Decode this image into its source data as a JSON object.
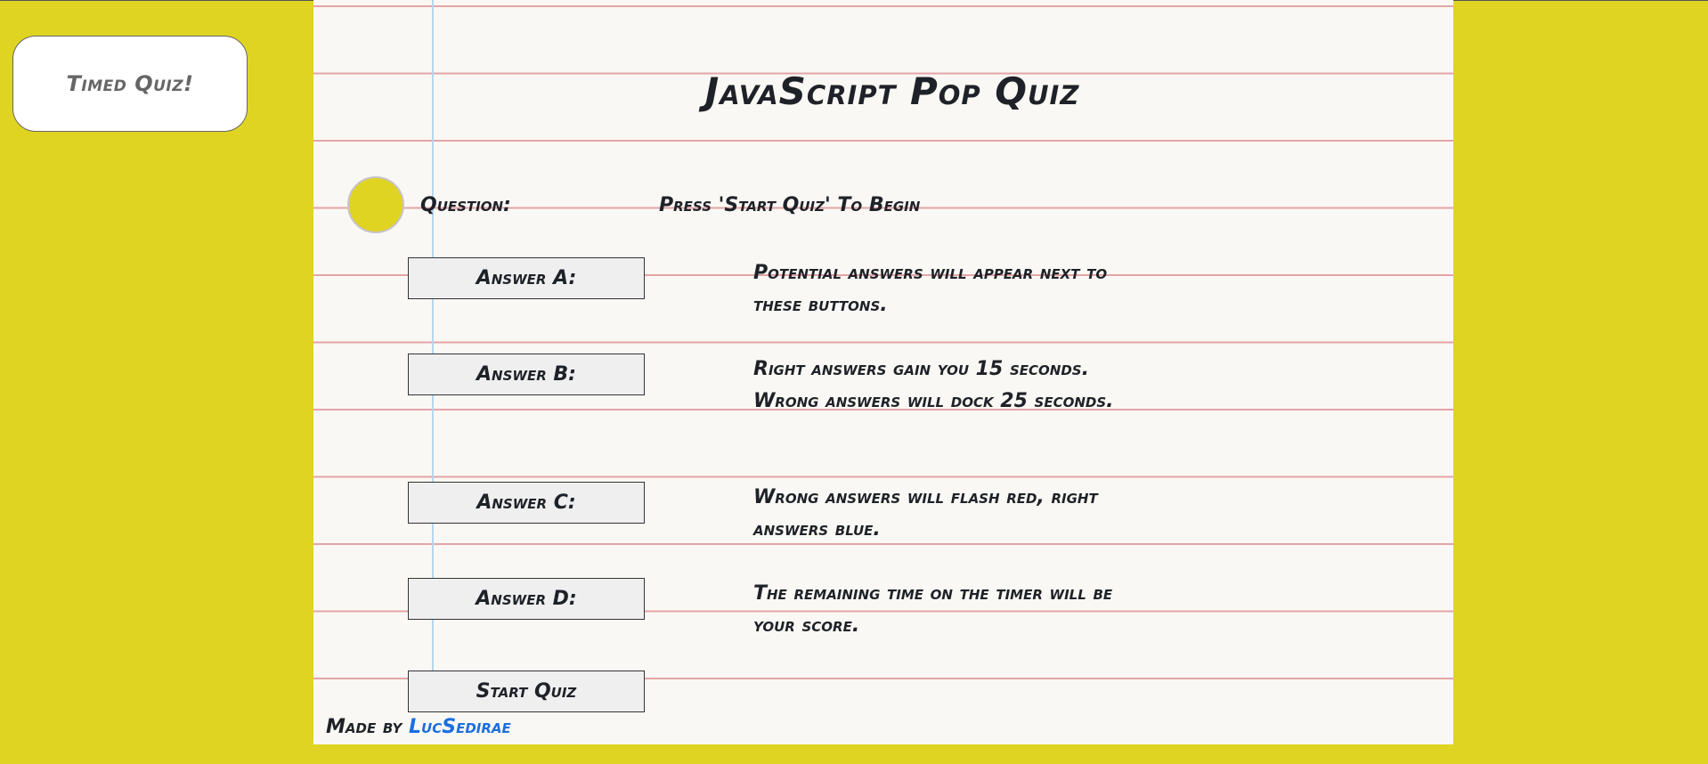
{
  "timer": {
    "label": "Timed Quiz!"
  },
  "header": {
    "title": "JavaScript Pop Quiz"
  },
  "question": {
    "label": "Question:",
    "text": "Press 'Start Quiz' To Begin"
  },
  "answers": [
    {
      "button_label": "Answer A:",
      "text": "Potential answers will appear next to these buttons."
    },
    {
      "button_label": "Answer B:",
      "text": "Right answers gain you 15 seconds. Wrong answers will dock 25 seconds."
    },
    {
      "button_label": "Answer C:",
      "text": "Wrong answers will flash red, right answers blue."
    },
    {
      "button_label": "Answer D:",
      "text": "The remaining time on the timer will be your score."
    }
  ],
  "start_button": {
    "label": "Start Quiz"
  },
  "footer": {
    "prefix": "Made by",
    "author_link": "LucSedirae"
  },
  "colors": {
    "background": "#e0d422",
    "paper": "#faf8f4",
    "ruled_line": "#e3a4a8",
    "margin_line": "#b6d6ee",
    "link": "#1a6fe0"
  }
}
